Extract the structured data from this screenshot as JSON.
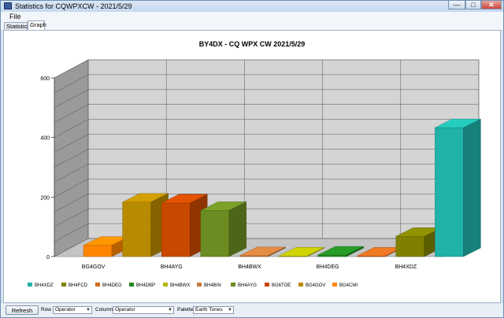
{
  "window": {
    "title": "Statistics for CQWPXCW - 2021/5/29",
    "min_label": "—",
    "max_label": "□",
    "close_label": "✕"
  },
  "menu": {
    "file": "File"
  },
  "tabs": [
    {
      "label": "Statistics"
    },
    {
      "label": "Graph"
    }
  ],
  "chart_data": {
    "type": "bar",
    "title": "BY4DX - CQ WPX  CW 2021/5/29",
    "xlabel": "",
    "ylabel": "",
    "ylim": [
      0,
      600
    ],
    "yticks": [
      0,
      200,
      400,
      600
    ],
    "categories": [
      "BG4GOV",
      "BH4AYG",
      "BH4BWX",
      "BH4DEG",
      "BH4XDZ"
    ],
    "bars": [
      {
        "name": "BG4CMI",
        "value": 38
      },
      {
        "name": "BG4GOV",
        "value": 183
      },
      {
        "name": "BG6TOE",
        "value": 180
      },
      {
        "name": "BH4AYG",
        "value": 155
      },
      {
        "name": "BH4BIN",
        "value": 3
      },
      {
        "name": "BH4BWX",
        "value": 2
      },
      {
        "name": "BH4DBP",
        "value": 5
      },
      {
        "name": "BH4DEG",
        "value": 2
      },
      {
        "name": "BH4FCD",
        "value": 68
      },
      {
        "name": "BH4XDZ",
        "value": 433
      }
    ],
    "legend": [
      "BH4XDZ",
      "BH4FCD",
      "BH4DEG",
      "BH4DBP",
      "BH4BWX",
      "BH4BIN",
      "BH4AYG",
      "BG6TOE",
      "BG4GOV",
      "BG4CMI"
    ],
    "colors": {
      "BG4CMI": "#ff8400",
      "BG4GOV": "#b88a00",
      "BG6TOE": "#c84800",
      "BH4AYG": "#6b8c22",
      "BH4BIN": "#c77a3c",
      "BH4BWX": "#b5b800",
      "BH4DBP": "#228822",
      "BH4DEG": "#d26a20",
      "BH4FCD": "#808000",
      "BH4XDZ": "#20b2a6"
    },
    "legend_position": "bottom",
    "grid": true,
    "style": "3d"
  },
  "bottom": {
    "refresh": "Refresh",
    "row_label": "Row",
    "row_value": "Operator",
    "column_label": "Column",
    "column_value": "Operator",
    "palette_label": "Palette",
    "palette_value": "Earth Tones",
    "dropdown_arrow": "▼"
  }
}
